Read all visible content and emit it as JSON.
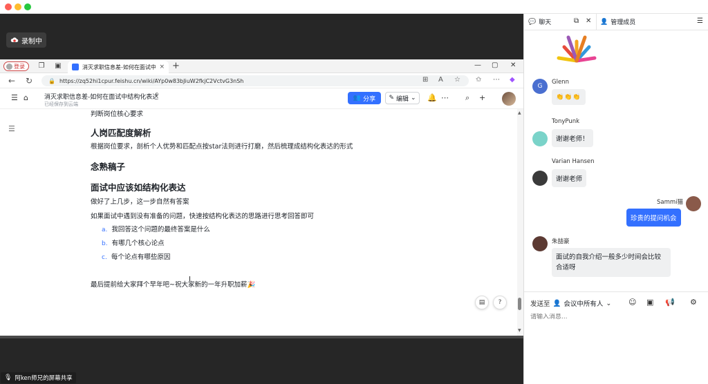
{
  "meeting": {
    "recording_label": "录制中",
    "share_label": "阿ken师兄的屏幕共享"
  },
  "browser": {
    "login_label": "登录",
    "tab_title": "消灭求职信息差-如何在面试中结构化",
    "tab_close": "×",
    "new_tab": "+",
    "url": "https://zq52hi1cpur.feishu.cn/wiki/AYp0w83bJiuW2fkjC2VctvG3nSh",
    "window_controls": [
      "—",
      "▢",
      "✕"
    ]
  },
  "doc": {
    "title": "消灭求职信息差-如何在面试中结构化表达",
    "saved_status": "已经保存到云端",
    "share_button": "分享",
    "edit_button": "编辑",
    "lines": {
      "l1": "判断岗位核心要求",
      "h1": "人岗匹配度解析",
      "l2": "根据岗位要求，剖析个人优势和匹配点按star法则进行打磨，然后梳理成结构化表达的形式",
      "h2": "念熟稿子",
      "h3": "面试中应该如结构化表达",
      "l3": "做好了上几步，这一步自然有答案",
      "l4": "如果面试中遇到没有准备的问题，快速按结构化表达的思路进行思考回答即可",
      "li_a_mark": "a.",
      "li_a": "我回答这个问题的最终答案是什么",
      "li_b_mark": "b.",
      "li_b": "有哪几个核心论点",
      "li_c_mark": "c.",
      "li_c": "每个论点有哪些原因",
      "l5": "最后提前给大家拜个早年吧~祝大家新的一年升职加薪🎉"
    }
  },
  "panel": {
    "tab_chat": "聊天",
    "tab_members": "管理成员",
    "messages": [
      {
        "name": "Glenn",
        "avatar_letter": "G",
        "text": "👏👏👏"
      },
      {
        "name": "TonyPunk",
        "text": "谢谢老师！"
      },
      {
        "name": "Varian  Hansen",
        "text": "谢谢老师"
      },
      {
        "name": "Sammi猫",
        "text": "珍贵的提问机会"
      },
      {
        "name": "朱喆豪",
        "text": "面试的自我介绍一般多少时间会比较合适呀"
      }
    ],
    "send_to_label": "发送至",
    "send_to_target": "会议中所有人",
    "input_placeholder": "请输入消息..."
  },
  "colors": {
    "accent": "#3370ff",
    "meeting_bg": "#262626"
  }
}
